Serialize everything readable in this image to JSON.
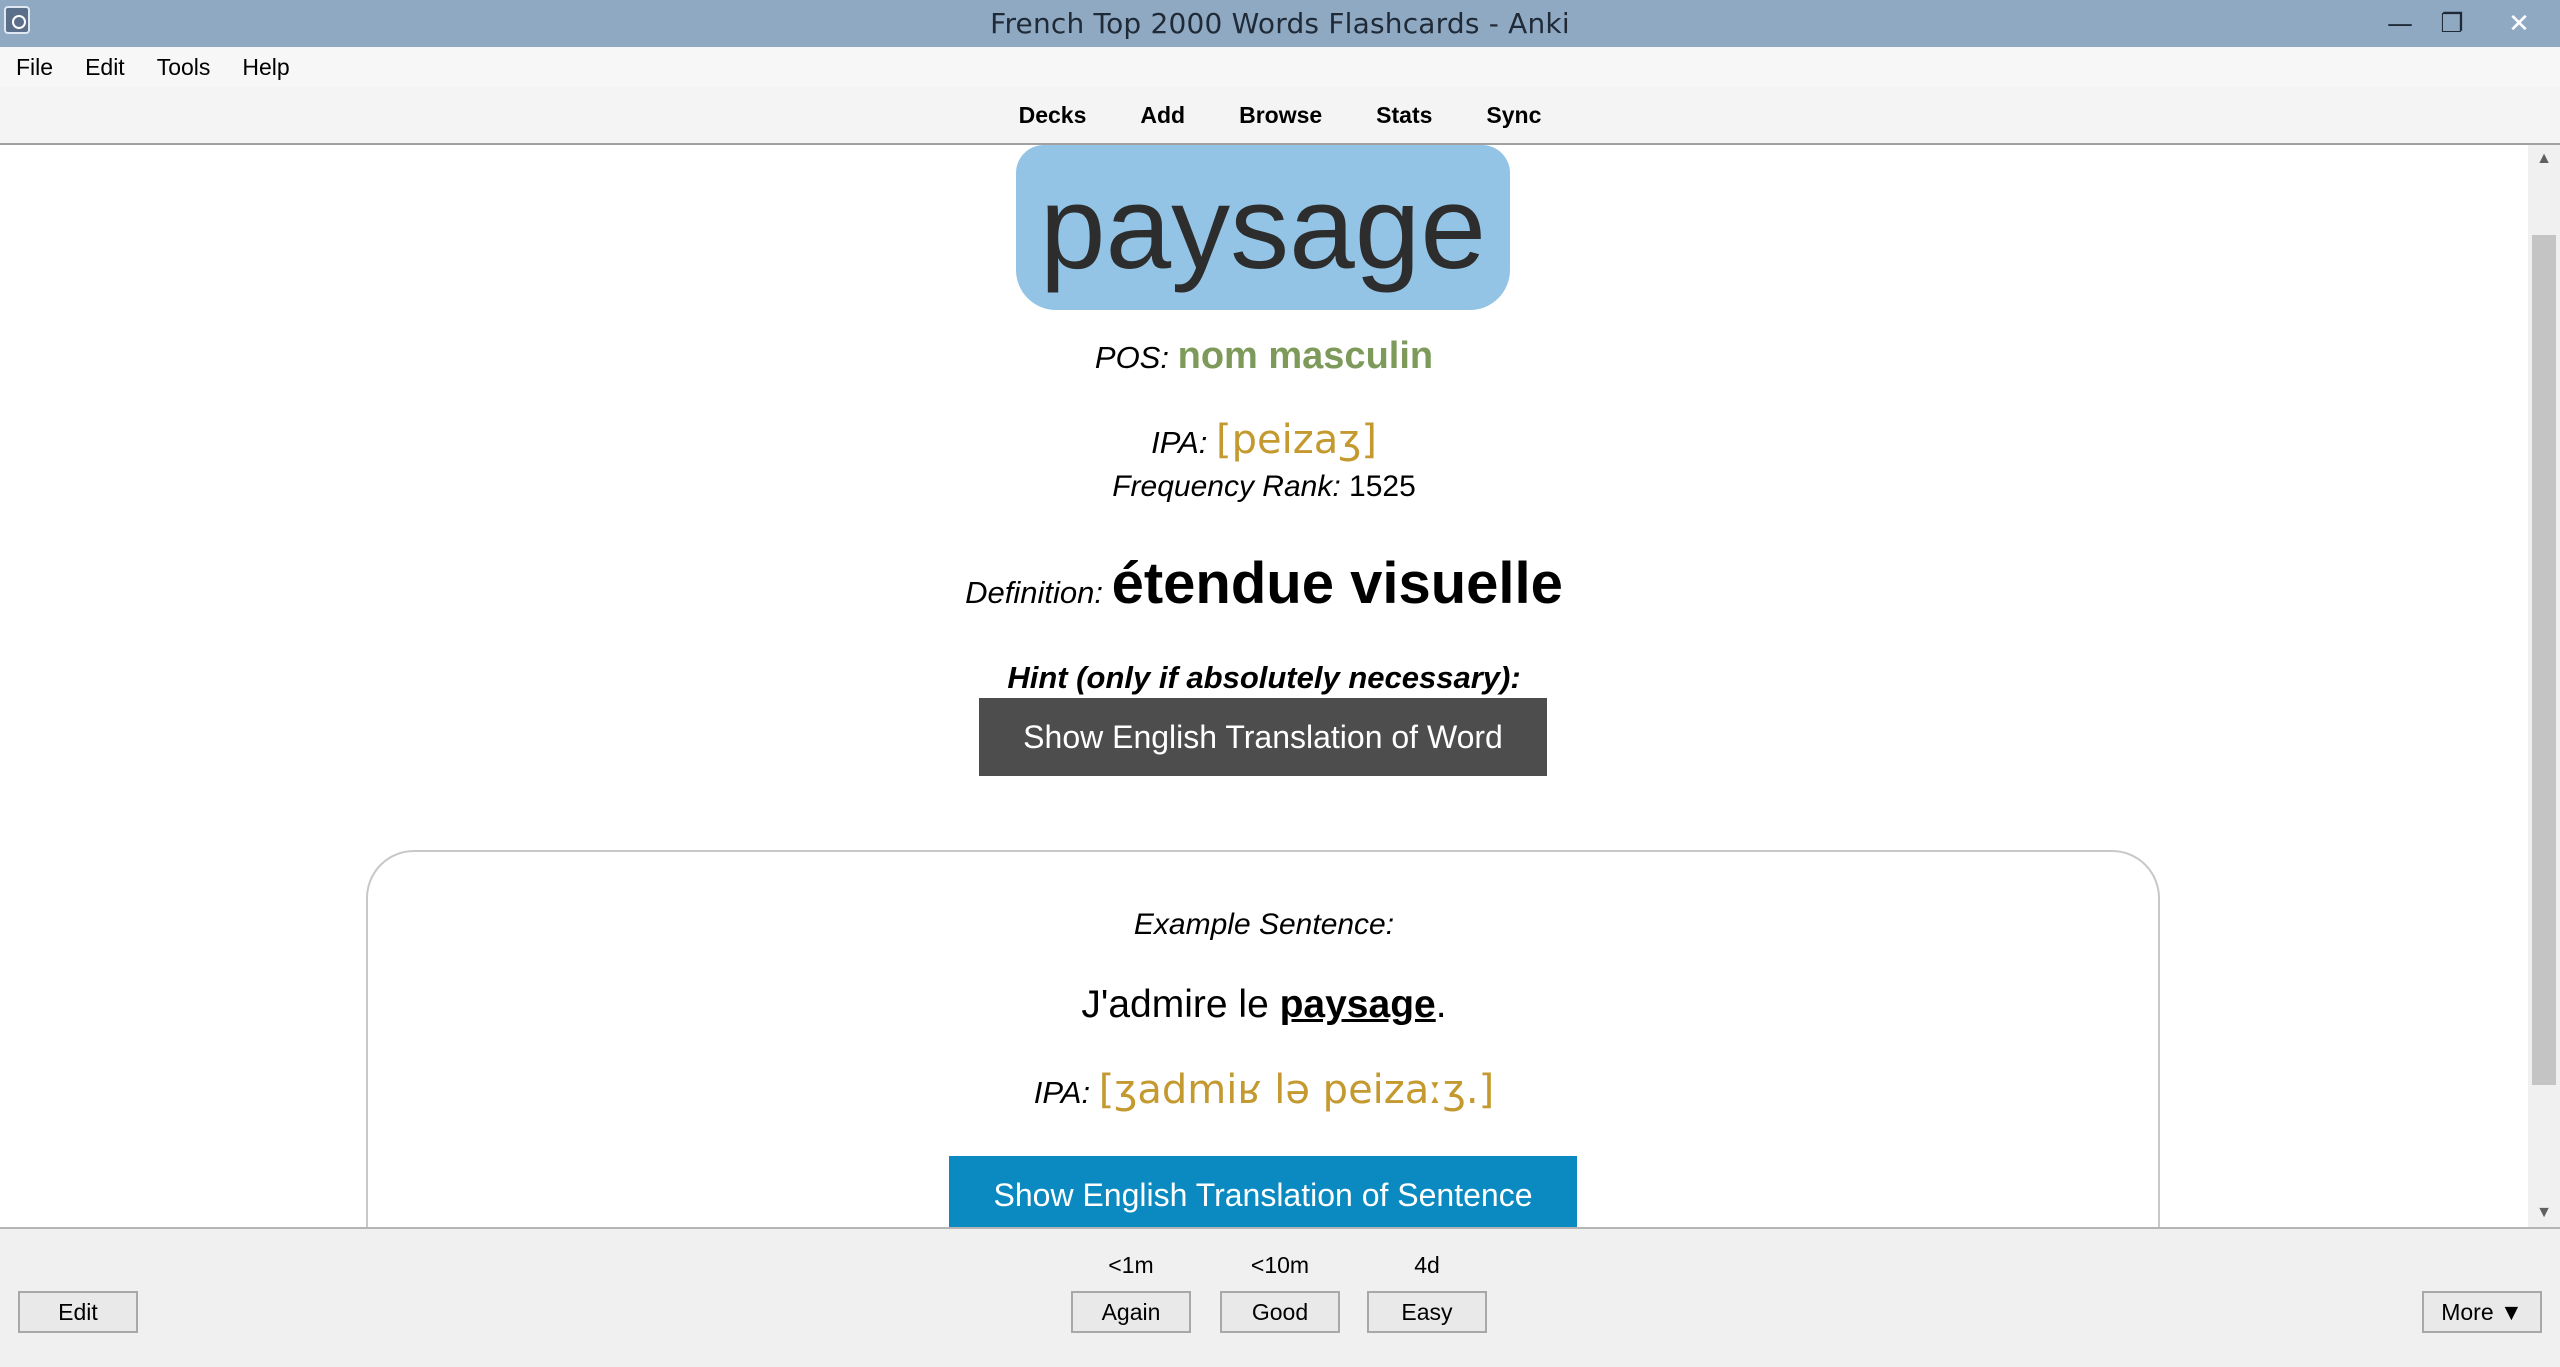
{
  "window": {
    "title": "French Top 2000 Words Flashcards - Anki",
    "minimize": "—",
    "restore": "❐",
    "close": "✕"
  },
  "menu": {
    "items": [
      "File",
      "Edit",
      "Tools",
      "Help"
    ]
  },
  "toolbar": {
    "items": [
      "Decks",
      "Add",
      "Browse",
      "Stats",
      "Sync"
    ]
  },
  "card": {
    "word": "paysage",
    "pos_label": "POS:",
    "pos_value": "nom masculin",
    "ipa_label": "IPA:",
    "ipa_value": "[peizaʒ]",
    "freq_label": "Frequency Rank:",
    "freq_value": "1525",
    "definition_label": "Definition:",
    "definition_value": "étendue visuelle",
    "hint_label": "Hint (only if absolutely necessary):",
    "hint_button": "Show English Translation of Word",
    "example": {
      "label": "Example Sentence:",
      "sentence_before": "J'admire le ",
      "sentence_word": "paysage",
      "sentence_after": ".",
      "ipa_label": "IPA:",
      "ipa_value": "[ʒadmiʁ lə peizaːʒ.]",
      "button": "Show English Translation of Sentence"
    }
  },
  "colors": {
    "word_box": "#93c4e6",
    "pos": "#7d9a5a",
    "ipa": "#c49a30",
    "hint_button": "#4d4d4d",
    "sentence_button": "#0a8ac0"
  },
  "answers": {
    "edit": "Edit",
    "more": "More ▼",
    "again": {
      "label": "Again",
      "interval": "<1m"
    },
    "good": {
      "label": "Good",
      "interval": "<10m"
    },
    "easy": {
      "label": "Easy",
      "interval": "4d"
    }
  },
  "scroll": {
    "up": "▲",
    "down": "▼"
  }
}
